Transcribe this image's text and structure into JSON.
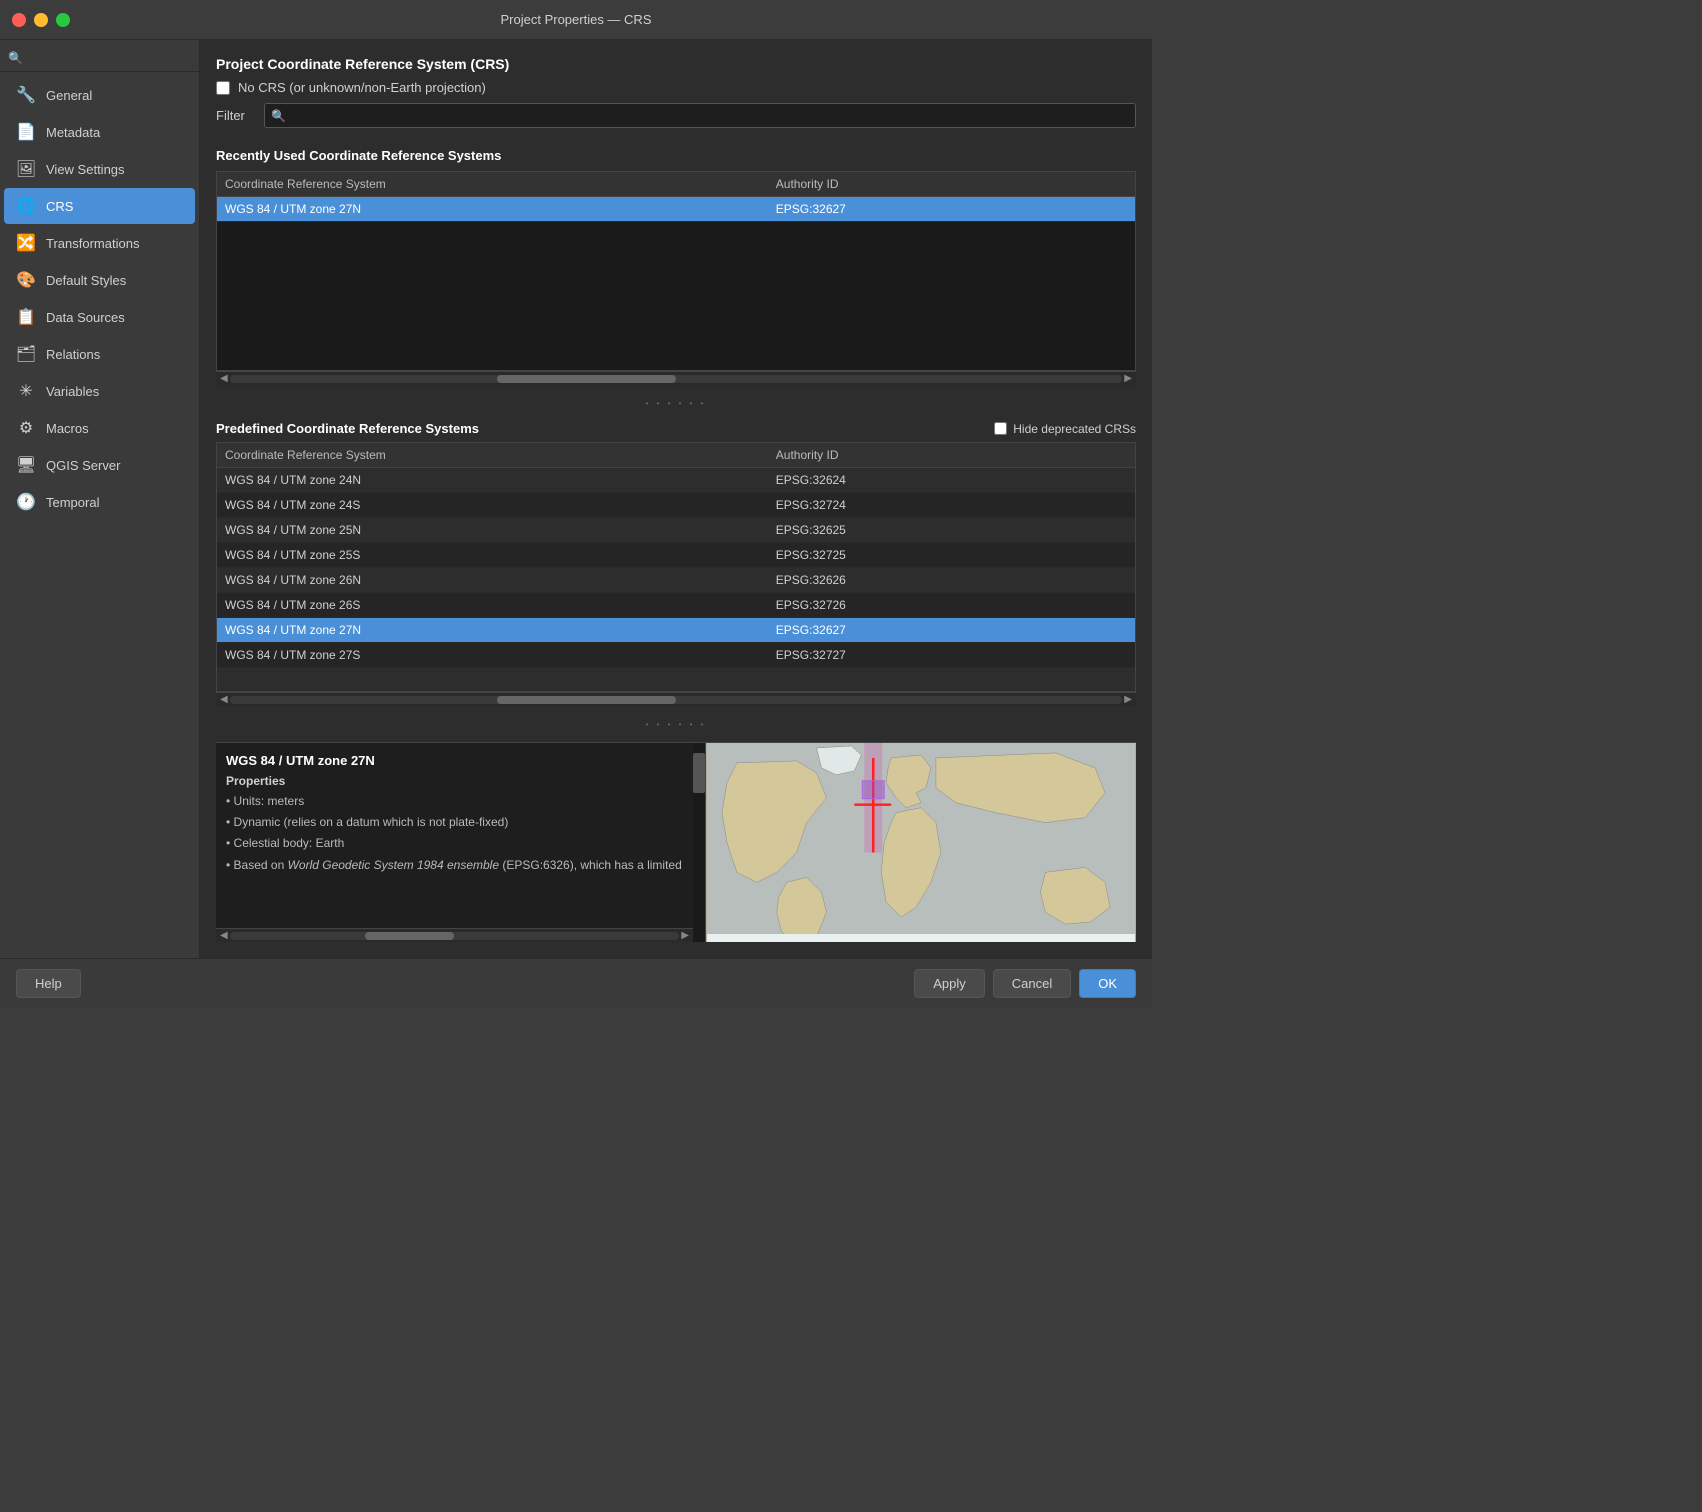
{
  "window": {
    "title": "Project Properties — CRS"
  },
  "sidebar": {
    "search_placeholder": "",
    "items": [
      {
        "id": "general",
        "label": "General",
        "icon": "🔧",
        "active": false
      },
      {
        "id": "metadata",
        "label": "Metadata",
        "icon": "📄",
        "active": false
      },
      {
        "id": "view-settings",
        "label": "View Settings",
        "icon": "🖼",
        "active": false
      },
      {
        "id": "crs",
        "label": "CRS",
        "icon": "🌐",
        "active": true
      },
      {
        "id": "transformations",
        "label": "Transformations",
        "icon": "🔀",
        "active": false
      },
      {
        "id": "default-styles",
        "label": "Default Styles",
        "icon": "🎨",
        "active": false
      },
      {
        "id": "data-sources",
        "label": "Data Sources",
        "icon": "📋",
        "active": false
      },
      {
        "id": "relations",
        "label": "Relations",
        "icon": "🗂",
        "active": false
      },
      {
        "id": "variables",
        "label": "Variables",
        "icon": "✳",
        "active": false
      },
      {
        "id": "macros",
        "label": "Macros",
        "icon": "⚙",
        "active": false
      },
      {
        "id": "qgis-server",
        "label": "QGIS Server",
        "icon": "🖥",
        "active": false
      },
      {
        "id": "temporal",
        "label": "Temporal",
        "icon": "🕐",
        "active": false
      }
    ]
  },
  "content": {
    "section_title": "Project Coordinate Reference System (CRS)",
    "no_crs_label": "No CRS (or unknown/non-Earth projection)",
    "no_crs_checked": false,
    "filter_label": "Filter",
    "recently_used_title": "Recently Used Coordinate Reference Systems",
    "recently_used_col1": "Coordinate Reference System",
    "recently_used_col2": "Authority ID",
    "recently_used_rows": [
      {
        "crs": "WGS 84 / UTM zone 27N",
        "authority": "EPSG:32627",
        "selected": true
      }
    ],
    "predefined_title": "Predefined Coordinate Reference Systems",
    "hide_deprecated_label": "Hide deprecated CRSs",
    "predefined_col1": "Coordinate Reference System",
    "predefined_col2": "Authority ID",
    "predefined_rows": [
      {
        "crs": "WGS 84 / UTM zone 24N",
        "authority": "EPSG:32624",
        "selected": false,
        "alt": false
      },
      {
        "crs": "WGS 84 / UTM zone 24S",
        "authority": "EPSG:32724",
        "selected": false,
        "alt": true
      },
      {
        "crs": "WGS 84 / UTM zone 25N",
        "authority": "EPSG:32625",
        "selected": false,
        "alt": false
      },
      {
        "crs": "WGS 84 / UTM zone 25S",
        "authority": "EPSG:32725",
        "selected": false,
        "alt": true
      },
      {
        "crs": "WGS 84 / UTM zone 26N",
        "authority": "EPSG:32626",
        "selected": false,
        "alt": false
      },
      {
        "crs": "WGS 84 / UTM zone 26S",
        "authority": "EPSG:32726",
        "selected": false,
        "alt": true
      },
      {
        "crs": "WGS 84 / UTM zone 27N",
        "authority": "EPSG:32627",
        "selected": true,
        "alt": false
      },
      {
        "crs": "WGS 84 / UTM zone 27S",
        "authority": "EPSG:32727",
        "selected": false,
        "alt": true
      }
    ],
    "crs_info_title": "WGS 84 / UTM zone 27N",
    "crs_info_subtitle": "Properties",
    "crs_properties": [
      "Units: meters",
      "Dynamic (relies on a datum which is not plate-fixed)",
      "Celestial body: Earth",
      "Based on World Geodetic System 1984 ensemble (EPSG:6326), which has a limited"
    ]
  },
  "footer": {
    "help_label": "Help",
    "apply_label": "Apply",
    "cancel_label": "Cancel",
    "ok_label": "OK"
  }
}
